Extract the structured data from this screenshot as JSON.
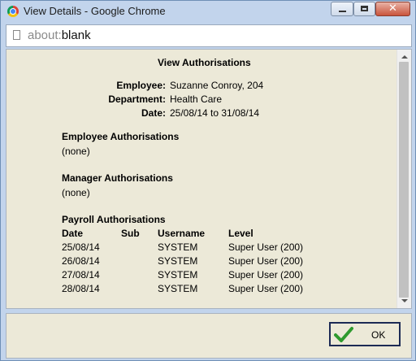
{
  "window": {
    "title": "View Details - Google Chrome"
  },
  "browser": {
    "url_scheme": "about:",
    "url_rest": "blank"
  },
  "report": {
    "heading": "View Authorisations",
    "employee_label": "Employee:",
    "employee_value": "Suzanne Conroy,  204",
    "department_label": "Department:",
    "department_value": "Health Care",
    "date_label": "Date:",
    "date_value": "25/08/14 to 31/08/14",
    "employee_auth": {
      "title": "Employee Authorisations",
      "value": "(none)"
    },
    "manager_auth": {
      "title": "Manager Authorisations",
      "value": "(none)"
    },
    "payroll_auth": {
      "title": "Payroll Authorisations",
      "columns": [
        "Date",
        "Sub",
        "Username",
        "Level"
      ],
      "rows": [
        [
          "25/08/14",
          "",
          "SYSTEM",
          "Super User (200)"
        ],
        [
          "26/08/14",
          "",
          "SYSTEM",
          "Super User (200)"
        ],
        [
          "27/08/14",
          "",
          "SYSTEM",
          "Super User (200)"
        ],
        [
          "28/08/14",
          "",
          "SYSTEM",
          "Super User (200)"
        ]
      ]
    }
  },
  "footer": {
    "ok_label": "OK"
  },
  "icons": {
    "app": "chrome-icon",
    "page": "page-icon",
    "ok": "checkmark-icon"
  },
  "colors": {
    "content_bg": "#ece9d8",
    "frame": "#c2d4ec",
    "check": "#2e9a2e"
  }
}
